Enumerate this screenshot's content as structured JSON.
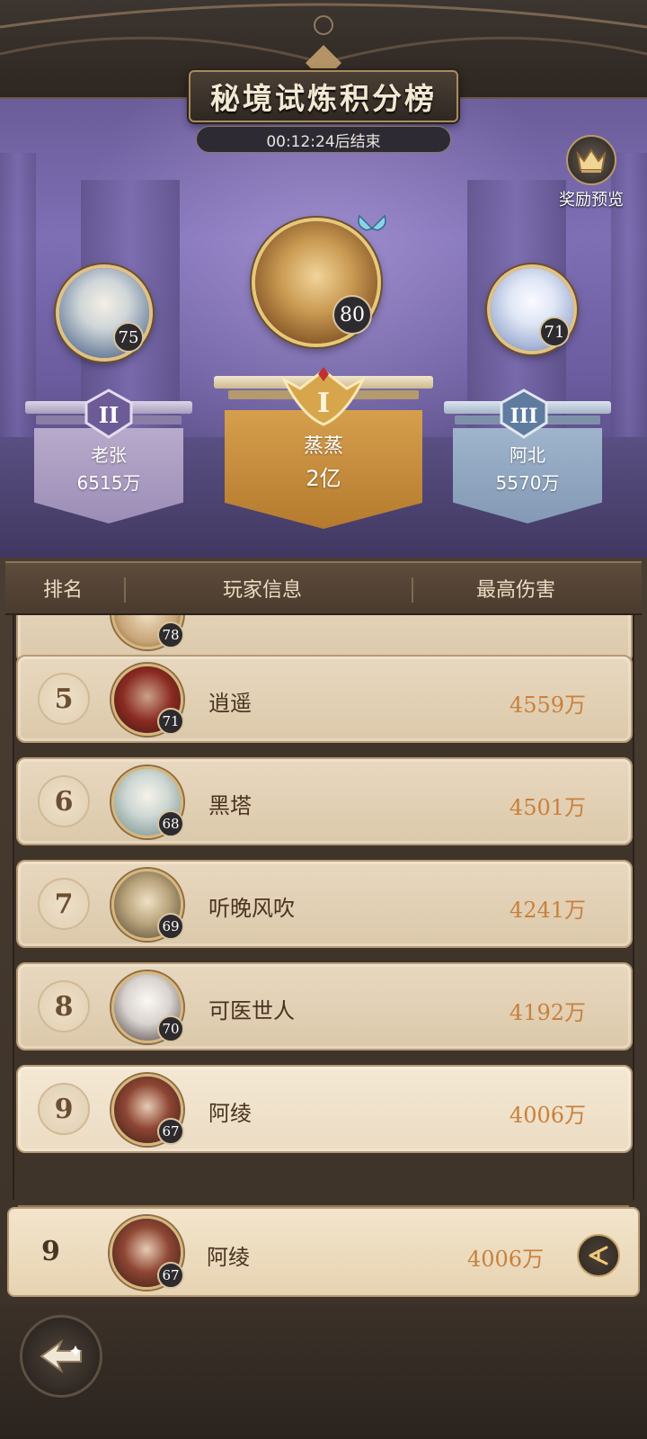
{
  "title": "秘境试炼积分榜",
  "timer": "00:12:24后结束",
  "reward_preview": {
    "label": "奖励预览",
    "icon": "crown-icon"
  },
  "podium": [
    {
      "rank": "II",
      "name": "老张",
      "score": "6515万",
      "level": "75",
      "color": "#9c8db7"
    },
    {
      "rank": "I",
      "name": "蒸蒸",
      "score": "2亿",
      "level": "80",
      "color": "#c98b3a"
    },
    {
      "rank": "III",
      "name": "阿北",
      "score": "5570万",
      "level": "71",
      "color": "#8399b5"
    }
  ],
  "table_headers": {
    "rank": "排名",
    "player_info": "玩家信息",
    "max_damage": "最高伤害"
  },
  "partial_row": {
    "level": "78"
  },
  "rows": [
    {
      "rank": "5",
      "name": "逍遥",
      "damage": "4559万",
      "level": "71"
    },
    {
      "rank": "6",
      "name": "黑塔",
      "damage": "4501万",
      "level": "68"
    },
    {
      "rank": "7",
      "name": "听晚风吹",
      "damage": "4241万",
      "level": "69"
    },
    {
      "rank": "8",
      "name": "可医世人",
      "damage": "4192万",
      "level": "70"
    },
    {
      "rank": "9",
      "name": "阿绫",
      "damage": "4006万",
      "level": "67"
    }
  ],
  "my_entry": {
    "rank": "9",
    "name": "阿绫",
    "damage": "4006万",
    "level": "67"
  },
  "icons": {
    "share": "share-icon",
    "back": "back-arrow-icon"
  }
}
